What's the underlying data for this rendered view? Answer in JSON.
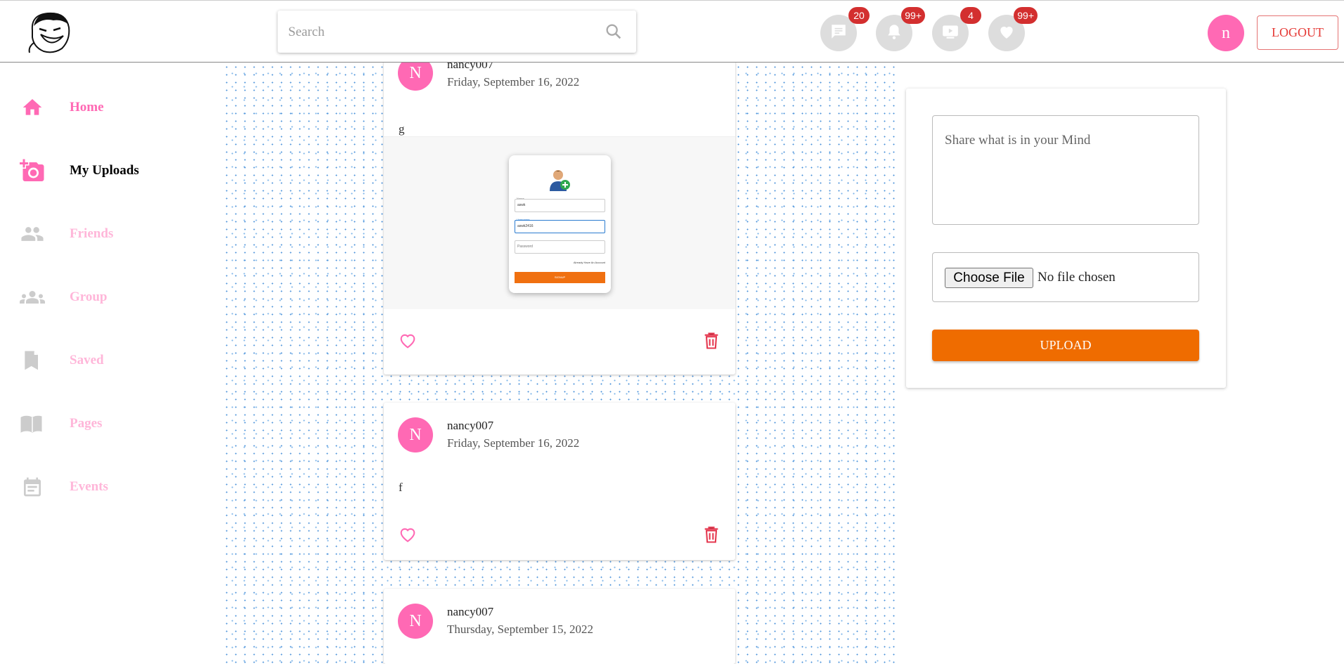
{
  "header": {
    "search_placeholder": "Search",
    "notifications": [
      {
        "icon": "message-icon",
        "count": "20"
      },
      {
        "icon": "bell-icon",
        "count": "99+"
      },
      {
        "icon": "video-icon",
        "count": "4"
      },
      {
        "icon": "heart-icon",
        "count": "99+"
      }
    ],
    "avatar_letter": "n",
    "logout_label": "LOGOUT"
  },
  "sidebar": {
    "items": [
      {
        "label": "Home",
        "icon": "home-icon",
        "color": "#ff69b4"
      },
      {
        "label": "My Uploads",
        "icon": "camera-add-icon",
        "color": "#000000"
      },
      {
        "label": "Friends",
        "icon": "people-icon",
        "color": "#ffb6d9"
      },
      {
        "label": "Group",
        "icon": "groups-icon",
        "color": "#ffb6d9"
      },
      {
        "label": "Saved",
        "icon": "bookmark-icon",
        "color": "#ffb6d9"
      },
      {
        "label": "Pages",
        "icon": "book-icon",
        "color": "#ffb6d9"
      },
      {
        "label": "Events",
        "icon": "calendar-icon",
        "color": "#ffb6d9"
      }
    ]
  },
  "posts": [
    {
      "avatar": "N",
      "username": "nancy007",
      "date": "Friday, September 16, 2022",
      "text": "g",
      "image": {
        "name_label": "Name",
        "name_value": "aswk",
        "username_label": "Username",
        "username_value": "aswk2416",
        "password_label": "Password",
        "link": "Already Have An Account",
        "button": "SIGNUP"
      }
    },
    {
      "avatar": "N",
      "username": "nancy007",
      "date": "Friday, September 16, 2022",
      "text": "f"
    },
    {
      "avatar": "N",
      "username": "nancy007",
      "date": "Thursday, September 15, 2022"
    }
  ],
  "composer": {
    "placeholder": "Share what is in your Mind",
    "file_button": "Choose File",
    "file_status": "No file chosen",
    "upload_label": "UPLOAD"
  },
  "colors": {
    "accent": "#ff69b4",
    "upload": "#ef6c00",
    "badge": "#d32f2f",
    "delete": "#e53950"
  }
}
